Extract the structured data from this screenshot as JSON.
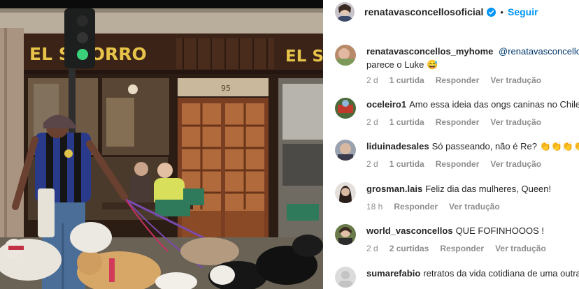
{
  "photo": {
    "sign_left": "EL S   CORRO",
    "sign_right": "EL SO",
    "door_number": "95"
  },
  "header": {
    "username": "renatavasconcellosoficial",
    "separator": "•",
    "follow_label": "Seguir",
    "verified_icon": "verified-badge-icon"
  },
  "comments": [
    {
      "username": "renatavasconcellos_myhome",
      "mention": "@renatavasconcellos",
      "text": "",
      "text_line2": "parece o Luke 😅",
      "time": "2 d",
      "likes": "1 curtida",
      "reply": "Responder",
      "translate": "Ver tradução"
    },
    {
      "username": "oceleiro1",
      "text": "Amo essa ideia das ongs caninas no Chile",
      "time": "2 d",
      "likes": "1 curtida",
      "reply": "Responder",
      "translate": "Ver tradução"
    },
    {
      "username": "liduinadesales",
      "text": "Só passeando, não é Re? 👏👏👏👏",
      "time": "2 d",
      "likes": "1 curtida",
      "reply": "Responder",
      "translate": "Ver tradução"
    },
    {
      "username": "grosman.lais",
      "text": "Feliz dia das mulheres, Queen!",
      "time": "18 h",
      "reply": "Responder",
      "translate": "Ver tradução"
    },
    {
      "username": "world_vasconcellos",
      "text": "QUE FOFINHOOOS !",
      "time": "2 d",
      "likes": "2 curtidas",
      "reply": "Responder",
      "translate": "Ver tradução"
    },
    {
      "username": "sumarefabio",
      "text": "retratos da vida cotidiana de uma outra"
    }
  ],
  "colors": {
    "link": "#0095f6",
    "muted": "#8e8e8e",
    "text": "#262626",
    "sign": "#e7c34a"
  }
}
